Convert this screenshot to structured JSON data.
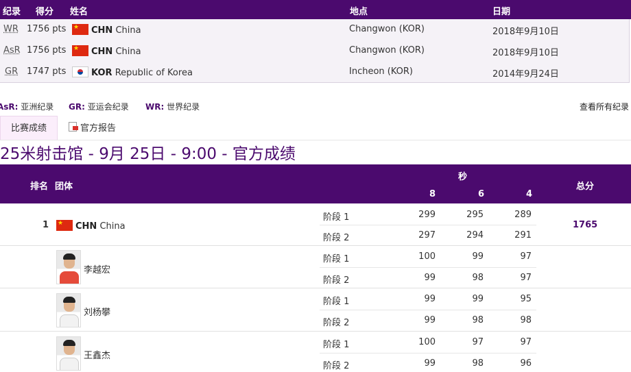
{
  "records": {
    "headers": {
      "code": "纪录",
      "score": "得分",
      "name": "姓名",
      "venue": "地点",
      "date": "日期"
    },
    "rows": [
      {
        "code": "WR",
        "score": "1756 pts",
        "noc": "CHN",
        "country": "China",
        "venue": "Changwon (KOR)",
        "date": "2018年9月10日"
      },
      {
        "code": "AsR",
        "score": "1756 pts",
        "noc": "CHN",
        "country": "China",
        "venue": "Changwon (KOR)",
        "date": "2018年9月10日"
      },
      {
        "code": "GR",
        "score": "1747 pts",
        "noc": "KOR",
        "country": "Republic of Korea",
        "venue": "Incheon (KOR)",
        "date": "2014年9月24日"
      }
    ]
  },
  "legend": {
    "asr_key": "AsR:",
    "asr_label": "亚洲纪录",
    "gr_key": "GR:",
    "gr_label": "亚运会纪录",
    "wr_key": "WR:",
    "wr_label": "世界纪录",
    "view_all": "查看所有纪录"
  },
  "tabs": {
    "results": "比赛成绩",
    "report": "官方报告"
  },
  "heading": "25米射击馆 - 9月 25日 - 9:00 - 官方成绩",
  "results": {
    "headers": {
      "rank": "排名",
      "team": "团体",
      "seconds": "秒",
      "s8": "8",
      "s6": "6",
      "s4": "4",
      "total": "总分"
    },
    "team": {
      "rank": "1",
      "noc": "CHN",
      "country": "China",
      "total": "1765",
      "stages": [
        {
          "label": "阶段 1",
          "s8": "299",
          "s6": "295",
          "s4": "289"
        },
        {
          "label": "阶段 2",
          "s8": "297",
          "s6": "294",
          "s4": "291"
        }
      ]
    },
    "athletes": [
      {
        "name": "李越宏",
        "stages": [
          {
            "label": "阶段 1",
            "s8": "100",
            "s6": "99",
            "s4": "97"
          },
          {
            "label": "阶段 2",
            "s8": "99",
            "s6": "98",
            "s4": "97"
          }
        ]
      },
      {
        "name": "刘杨攀",
        "stages": [
          {
            "label": "阶段 1",
            "s8": "99",
            "s6": "99",
            "s4": "95"
          },
          {
            "label": "阶段 2",
            "s8": "99",
            "s6": "98",
            "s4": "98"
          }
        ]
      },
      {
        "name": "王鑫杰",
        "stages": [
          {
            "label": "阶段 1",
            "s8": "100",
            "s6": "97",
            "s4": "97"
          },
          {
            "label": "阶段 2",
            "s8": "99",
            "s6": "98",
            "s4": "96"
          }
        ]
      }
    ]
  }
}
